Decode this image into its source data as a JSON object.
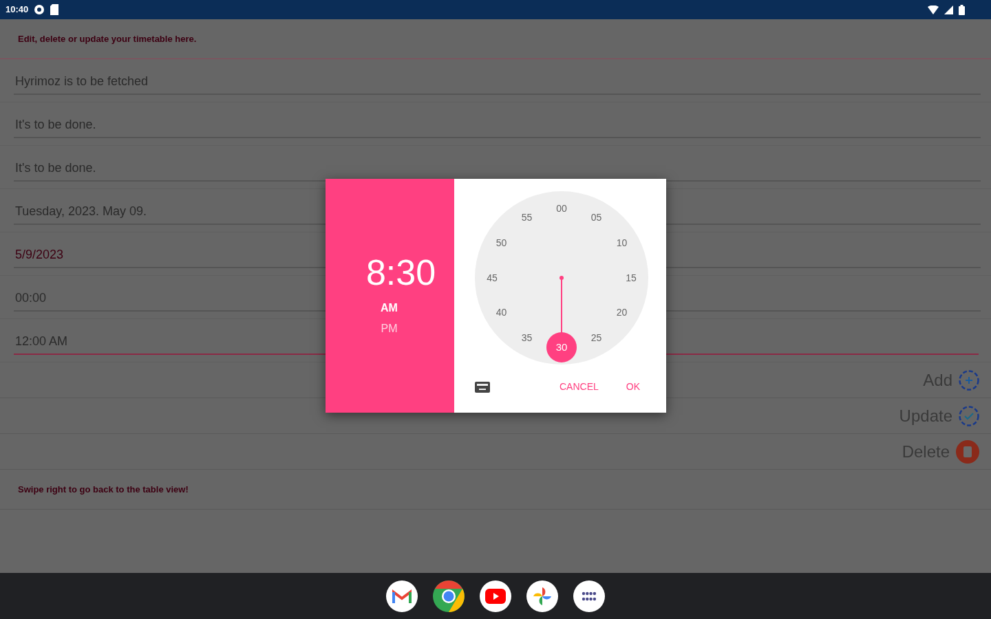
{
  "status_bar": {
    "time": "10:40"
  },
  "header": "Edit, delete or update your timetable here.",
  "fields": [
    {
      "value": "Hyrimoz is to be fetched",
      "focused": false,
      "color": "#2a2a2a"
    },
    {
      "value": "It's to be done.",
      "focused": false,
      "color": "#2a2a2a"
    },
    {
      "value": "It's to be done.",
      "focused": false,
      "color": "#2a2a2a"
    },
    {
      "value": "Tuesday, 2023. May 09.",
      "focused": false,
      "color": "#2a2a2a"
    },
    {
      "value": "5/9/2023",
      "focused": false,
      "color": "#3d0012"
    },
    {
      "value": "00:00",
      "focused": false,
      "color": "#2a2a2a"
    },
    {
      "value": "12:00 AM",
      "focused": true,
      "color": "#2a2a2a"
    }
  ],
  "actions": [
    {
      "label": "Add",
      "kind": "add"
    },
    {
      "label": "Update",
      "kind": "update"
    },
    {
      "label": "Delete",
      "kind": "delete"
    }
  ],
  "footer": "Swipe right to go back to the table view!",
  "dialog": {
    "time": "8:30",
    "periods": [
      {
        "label": "AM",
        "selected": true
      },
      {
        "label": "PM",
        "selected": false
      }
    ],
    "dial": [
      {
        "label": "00",
        "selected": false
      },
      {
        "label": "05",
        "selected": false
      },
      {
        "label": "10",
        "selected": false
      },
      {
        "label": "15",
        "selected": false
      },
      {
        "label": "20",
        "selected": false
      },
      {
        "label": "25",
        "selected": false
      },
      {
        "label": "30",
        "selected": true
      },
      {
        "label": "35",
        "selected": false
      },
      {
        "label": "40",
        "selected": false
      },
      {
        "label": "45",
        "selected": false
      },
      {
        "label": "50",
        "selected": false
      },
      {
        "label": "55",
        "selected": false
      }
    ],
    "buttons": [
      "CANCEL",
      "OK"
    ]
  },
  "taskbar": [
    {
      "kind": "mail"
    },
    {
      "kind": "browser"
    },
    {
      "kind": "video"
    },
    {
      "kind": "photos"
    },
    {
      "kind": "launcher"
    }
  ]
}
